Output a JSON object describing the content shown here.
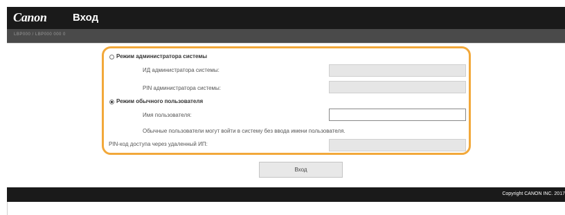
{
  "header": {
    "logo_text": "Canon",
    "page_title": "Вход",
    "device_name": "LBP000 / LBP000 000 0"
  },
  "login": {
    "admin_mode": {
      "label": "Режим администратора системы",
      "selected": false,
      "id_label": "ИД администратора системы:",
      "id_value": "",
      "pin_label": "PIN администратора системы:",
      "pin_value": ""
    },
    "user_mode": {
      "label": "Режим обычного пользователя",
      "selected": true,
      "username_label": "Имя пользователя:",
      "username_value": "",
      "hint": "Обычные пользователи могут войти в систему без ввода имени пользователя."
    },
    "remote_pin": {
      "label": "PIN-код доступа через удаленный ИП:",
      "value": ""
    },
    "login_button_label": "Вход"
  },
  "footer": {
    "copyright": "Copyright CANON INC. 2017"
  },
  "colors": {
    "header_bg": "#1a1a1a",
    "panel_border": "#f2a83a",
    "disabled_field": "#e6e6e6"
  }
}
